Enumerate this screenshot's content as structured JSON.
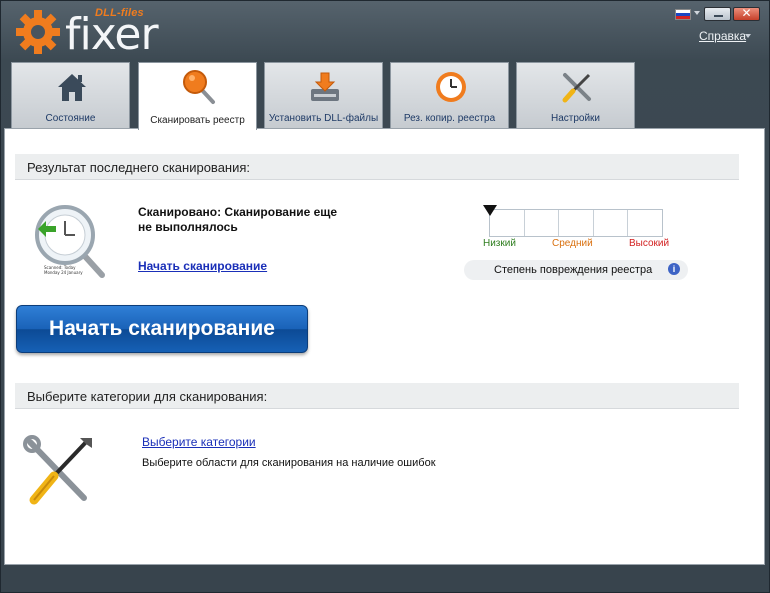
{
  "app": {
    "logo_small": "DLL-files",
    "logo_main": "fixer",
    "help_label": "Справка",
    "language_flag": "ru-flag"
  },
  "colors": {
    "accent_orange": "#f07c1e",
    "button_blue": "#1a62b8",
    "link_blue": "#1a2fb8",
    "low": "#2e7d1e",
    "medium": "#d9700f",
    "high": "#d21f1f"
  },
  "tabs": [
    {
      "label": "Состояние",
      "icon": "home-icon"
    },
    {
      "label": "Сканировать реестр",
      "icon": "magnifier-icon",
      "active": true
    },
    {
      "label": "Установить DLL-файлы",
      "icon": "install-icon"
    },
    {
      "label": "Рез. копир. реестра",
      "icon": "backup-clock-icon"
    },
    {
      "label": "Настройки",
      "icon": "tools-icon"
    }
  ],
  "scan": {
    "section_title": "Результат последнего сканирования:",
    "status_text": "Сканировано: Сканирование еще не выполнялось",
    "start_link": "Начать сканирование",
    "icon_caption_1": "Scanned: Today",
    "icon_caption_2": "Monday 24 January",
    "damage_levels": {
      "low": "Низкий",
      "medium": "Средний",
      "high": "Высокий"
    },
    "damage_label": "Степень повреждения реестра",
    "damage_level_value": 0,
    "big_button": "Начать сканирование"
  },
  "categories": {
    "section_title": "Выберите категории для сканирования:",
    "link": "Выберите категории",
    "description": "Выберите области для сканирования на наличие ошибок"
  }
}
